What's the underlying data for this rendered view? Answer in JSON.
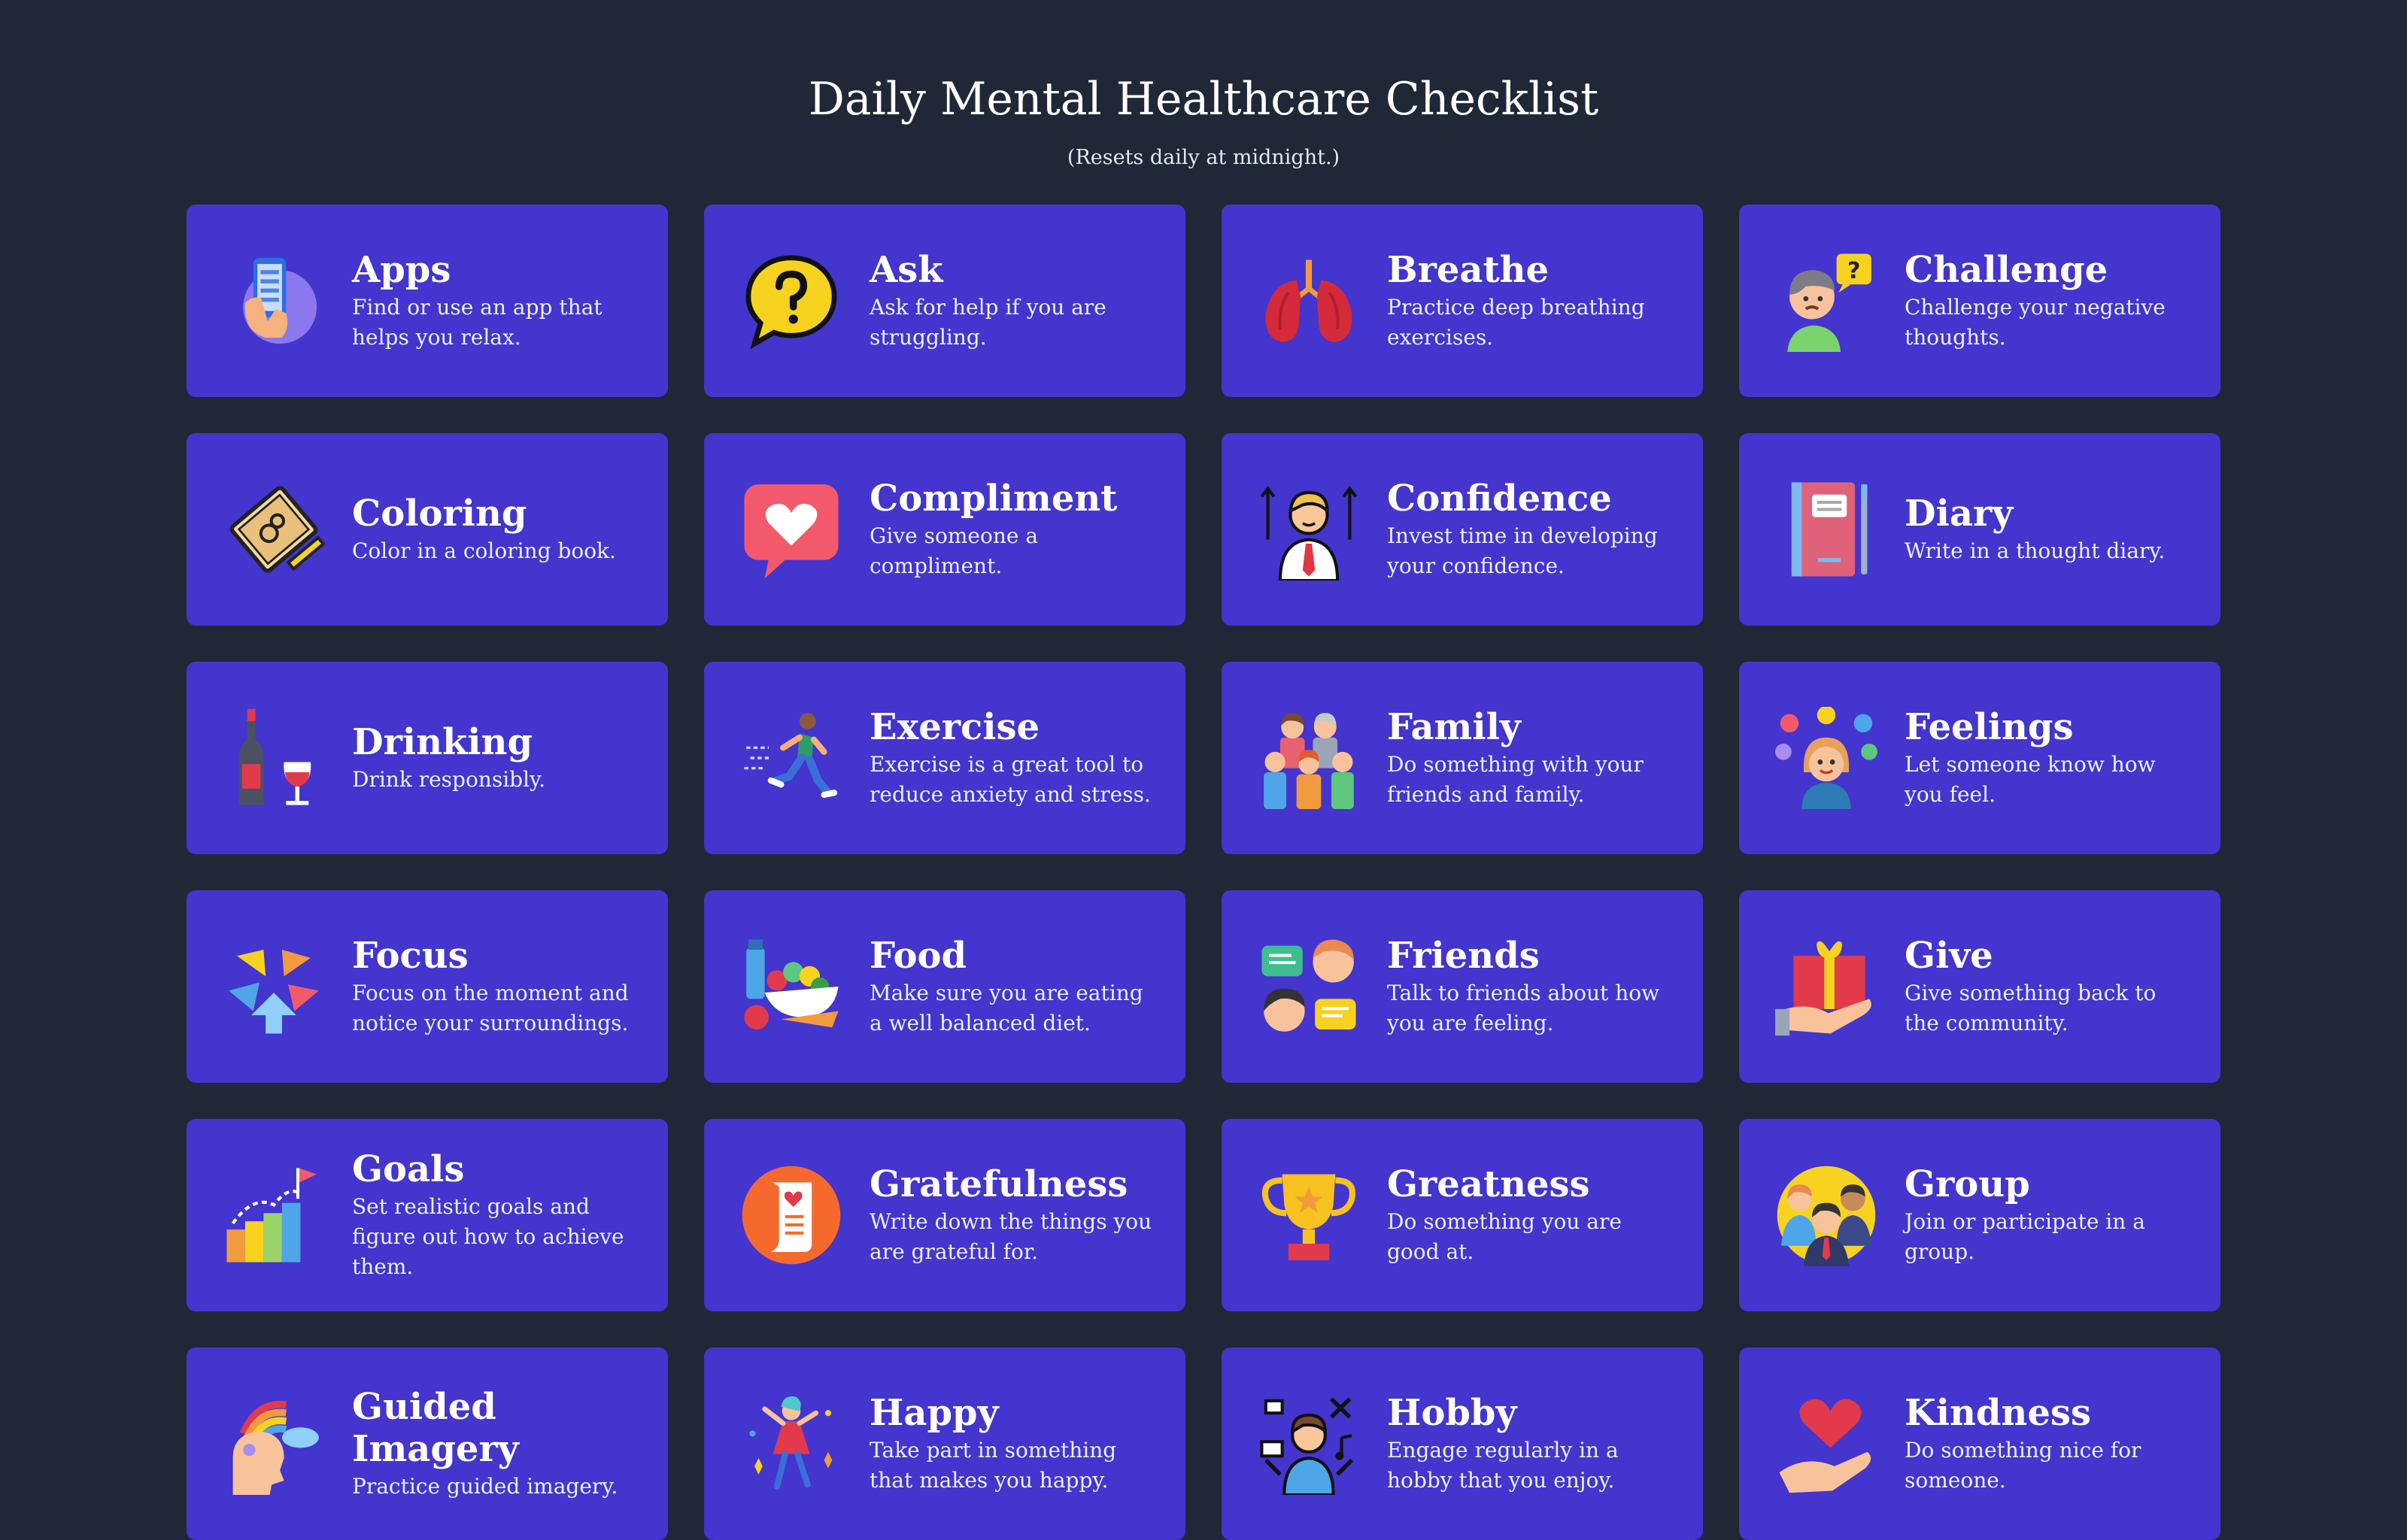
{
  "header": {
    "title": "Daily Mental Healthcare Checklist",
    "subtitle": "(Resets daily at midnight.)"
  },
  "colors": {
    "background": "#202837",
    "card": "#4335cd",
    "text": "#ffffff"
  },
  "cards": [
    {
      "title": "Apps",
      "desc": "Find or use an app that helps you relax.",
      "icon": "phone-app-icon"
    },
    {
      "title": "Ask",
      "desc": "Ask for help if you are struggling.",
      "icon": "question-bubble-icon"
    },
    {
      "title": "Breathe",
      "desc": "Practice deep breathing exercises.",
      "icon": "lungs-icon"
    },
    {
      "title": "Challenge",
      "desc": "Challenge your negative thoughts.",
      "icon": "thinking-person-icon"
    },
    {
      "title": "Coloring",
      "desc": "Color in a coloring book.",
      "icon": "coloring-book-icon"
    },
    {
      "title": "Compliment",
      "desc": "Give someone a compliment.",
      "icon": "heart-bubble-icon"
    },
    {
      "title": "Confidence",
      "desc": "Invest time in developing your confidence.",
      "icon": "confident-person-icon"
    },
    {
      "title": "Diary",
      "desc": "Write in a thought diary.",
      "icon": "diary-icon"
    },
    {
      "title": "Drinking",
      "desc": "Drink responsibly.",
      "icon": "wine-icon"
    },
    {
      "title": "Exercise",
      "desc": "Exercise is a great tool to reduce anxiety and stress.",
      "icon": "runner-icon"
    },
    {
      "title": "Family",
      "desc": "Do something with your friends and family.",
      "icon": "family-icon"
    },
    {
      "title": "Feelings",
      "desc": "Let someone know how you feel.",
      "icon": "feelings-icon"
    },
    {
      "title": "Focus",
      "desc": "Focus on the moment and notice your surroundings.",
      "icon": "focus-arrows-icon"
    },
    {
      "title": "Food",
      "desc": "Make sure you are eating a well balanced diet.",
      "icon": "healthy-food-icon"
    },
    {
      "title": "Friends",
      "desc": "Talk to friends about how you are feeling.",
      "icon": "friends-chat-icon"
    },
    {
      "title": "Give",
      "desc": "Give something back to the community.",
      "icon": "gift-hand-icon"
    },
    {
      "title": "Goals",
      "desc": "Set realistic goals and figure out how to achieve them.",
      "icon": "goal-chart-icon"
    },
    {
      "title": "Gratefulness",
      "desc": "Write down the things you are grateful for.",
      "icon": "grateful-scroll-icon"
    },
    {
      "title": "Greatness",
      "desc": "Do something you are good at.",
      "icon": "trophy-icon"
    },
    {
      "title": "Group",
      "desc": "Join or participate in a group.",
      "icon": "group-icon"
    },
    {
      "title": "Guided Imagery",
      "desc": "Practice guided imagery.",
      "icon": "imagination-icon"
    },
    {
      "title": "Happy",
      "desc": "Take part in something that makes you happy.",
      "icon": "dancing-person-icon"
    },
    {
      "title": "Hobby",
      "desc": "Engage regularly in a hobby that you enjoy.",
      "icon": "hobby-person-icon"
    },
    {
      "title": "Kindness",
      "desc": "Do something nice for someone.",
      "icon": "heart-hand-icon"
    }
  ]
}
